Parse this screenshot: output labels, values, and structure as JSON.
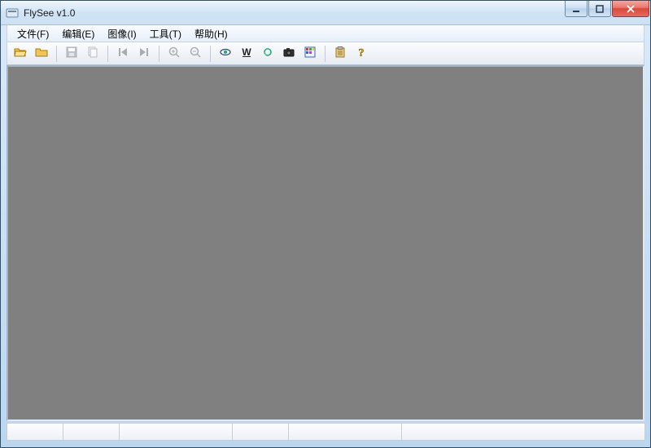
{
  "title": "FlySee v1.0",
  "menu": {
    "file": "文件(F)",
    "edit": "编辑(E)",
    "image": "图像(I)",
    "tools": "工具(T)",
    "help": "帮助(H)"
  },
  "toolbar": {
    "open": "open",
    "open_folder": "open-folder",
    "save": "save",
    "copy": "copy",
    "prev": "prev",
    "next": "next",
    "zoom_in": "zoom-in",
    "zoom_out": "zoom-out",
    "view": "view",
    "wide": "wide",
    "rotate": "rotate",
    "camera": "camera",
    "grid": "grid",
    "paste": "paste",
    "help": "help"
  },
  "status": {
    "panes": [
      "",
      "",
      "",
      "",
      "",
      ""
    ]
  }
}
